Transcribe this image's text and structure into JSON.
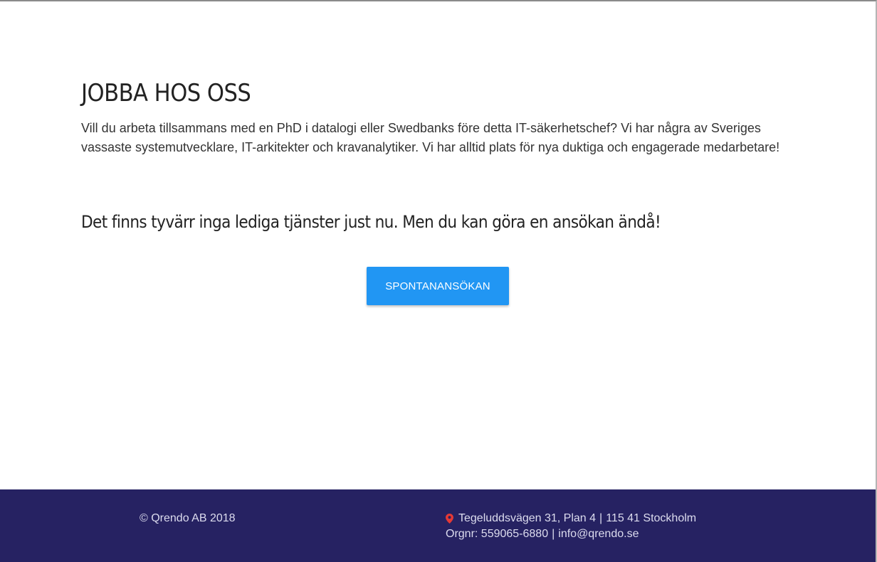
{
  "main": {
    "heading": "JOBBA HOS OSS",
    "intro": "Vill du arbeta tillsammans med en PhD i datalogi eller Swedbanks före detta IT-säkerhetschef? Vi har några av Sveriges vassaste systemutvecklare, IT-arkitekter och kravanalytiker. Vi har alltid plats för nya duktiga och engagerade medarbetare!",
    "notice": "Det finns tyvärr inga lediga tjänster just nu. Men du kan göra en ansökan ändå!",
    "apply_button_label": "SPONTANANSÖKAN"
  },
  "footer": {
    "copyright": "© Qrendo AB 2018",
    "address_icon": "map-pin-icon",
    "street": "Tegeluddsvägen 31, Plan 4",
    "postal": "115 41 Stockholm",
    "orgnr": "Orgnr: 559065-6880",
    "email": "info@qrendo.se",
    "separator": "|"
  },
  "colors": {
    "button": "#2196f3",
    "footer_bg": "#262262",
    "pin": "#e53935"
  }
}
